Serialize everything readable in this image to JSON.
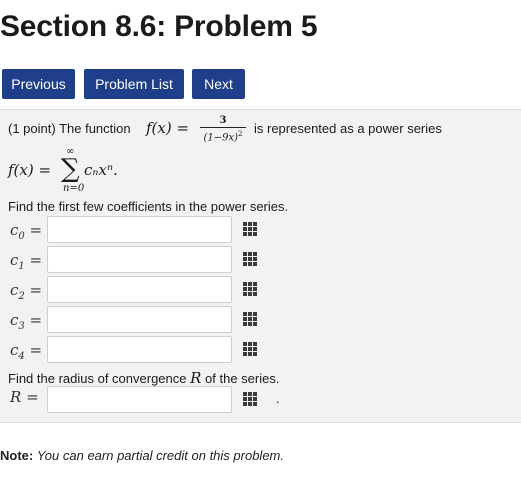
{
  "page_title": "Section 8.6: Problem 5",
  "nav": {
    "previous": "Previous",
    "problem_list": "Problem List",
    "next": "Next"
  },
  "problem": {
    "points": "(1 point) The function",
    "fx": "f(x) =",
    "numerator": "3",
    "denominator": "(1−9x)",
    "denominator_power": "2",
    "represented": "is represented as a power series",
    "series_lhs": "f(x) =",
    "sum_top": "∞",
    "sum_bottom": "n=0",
    "series_term": "cₙxⁿ.",
    "coefficients_prompt": "Find the first few coefficients in the power series.",
    "coefficients": [
      {
        "label": "c",
        "sub": "0",
        "value": ""
      },
      {
        "label": "c",
        "sub": "1",
        "value": ""
      },
      {
        "label": "c",
        "sub": "2",
        "value": ""
      },
      {
        "label": "c",
        "sub": "3",
        "value": ""
      },
      {
        "label": "c",
        "sub": "4",
        "value": ""
      }
    ],
    "radius_prompt_pre": "Find the radius of convergence",
    "radius_symbol": "R",
    "radius_prompt_post": "of the series.",
    "radius_label": "R",
    "radius_value": "",
    "radius_trailing": "."
  },
  "note": {
    "label": "Note:",
    "text": "You can earn partial credit on this problem."
  },
  "colors": {
    "nav_button": "#1f3f8a",
    "panel_background": "#f2f2f2"
  },
  "icons": {
    "palette": "equation-editor-icon"
  }
}
